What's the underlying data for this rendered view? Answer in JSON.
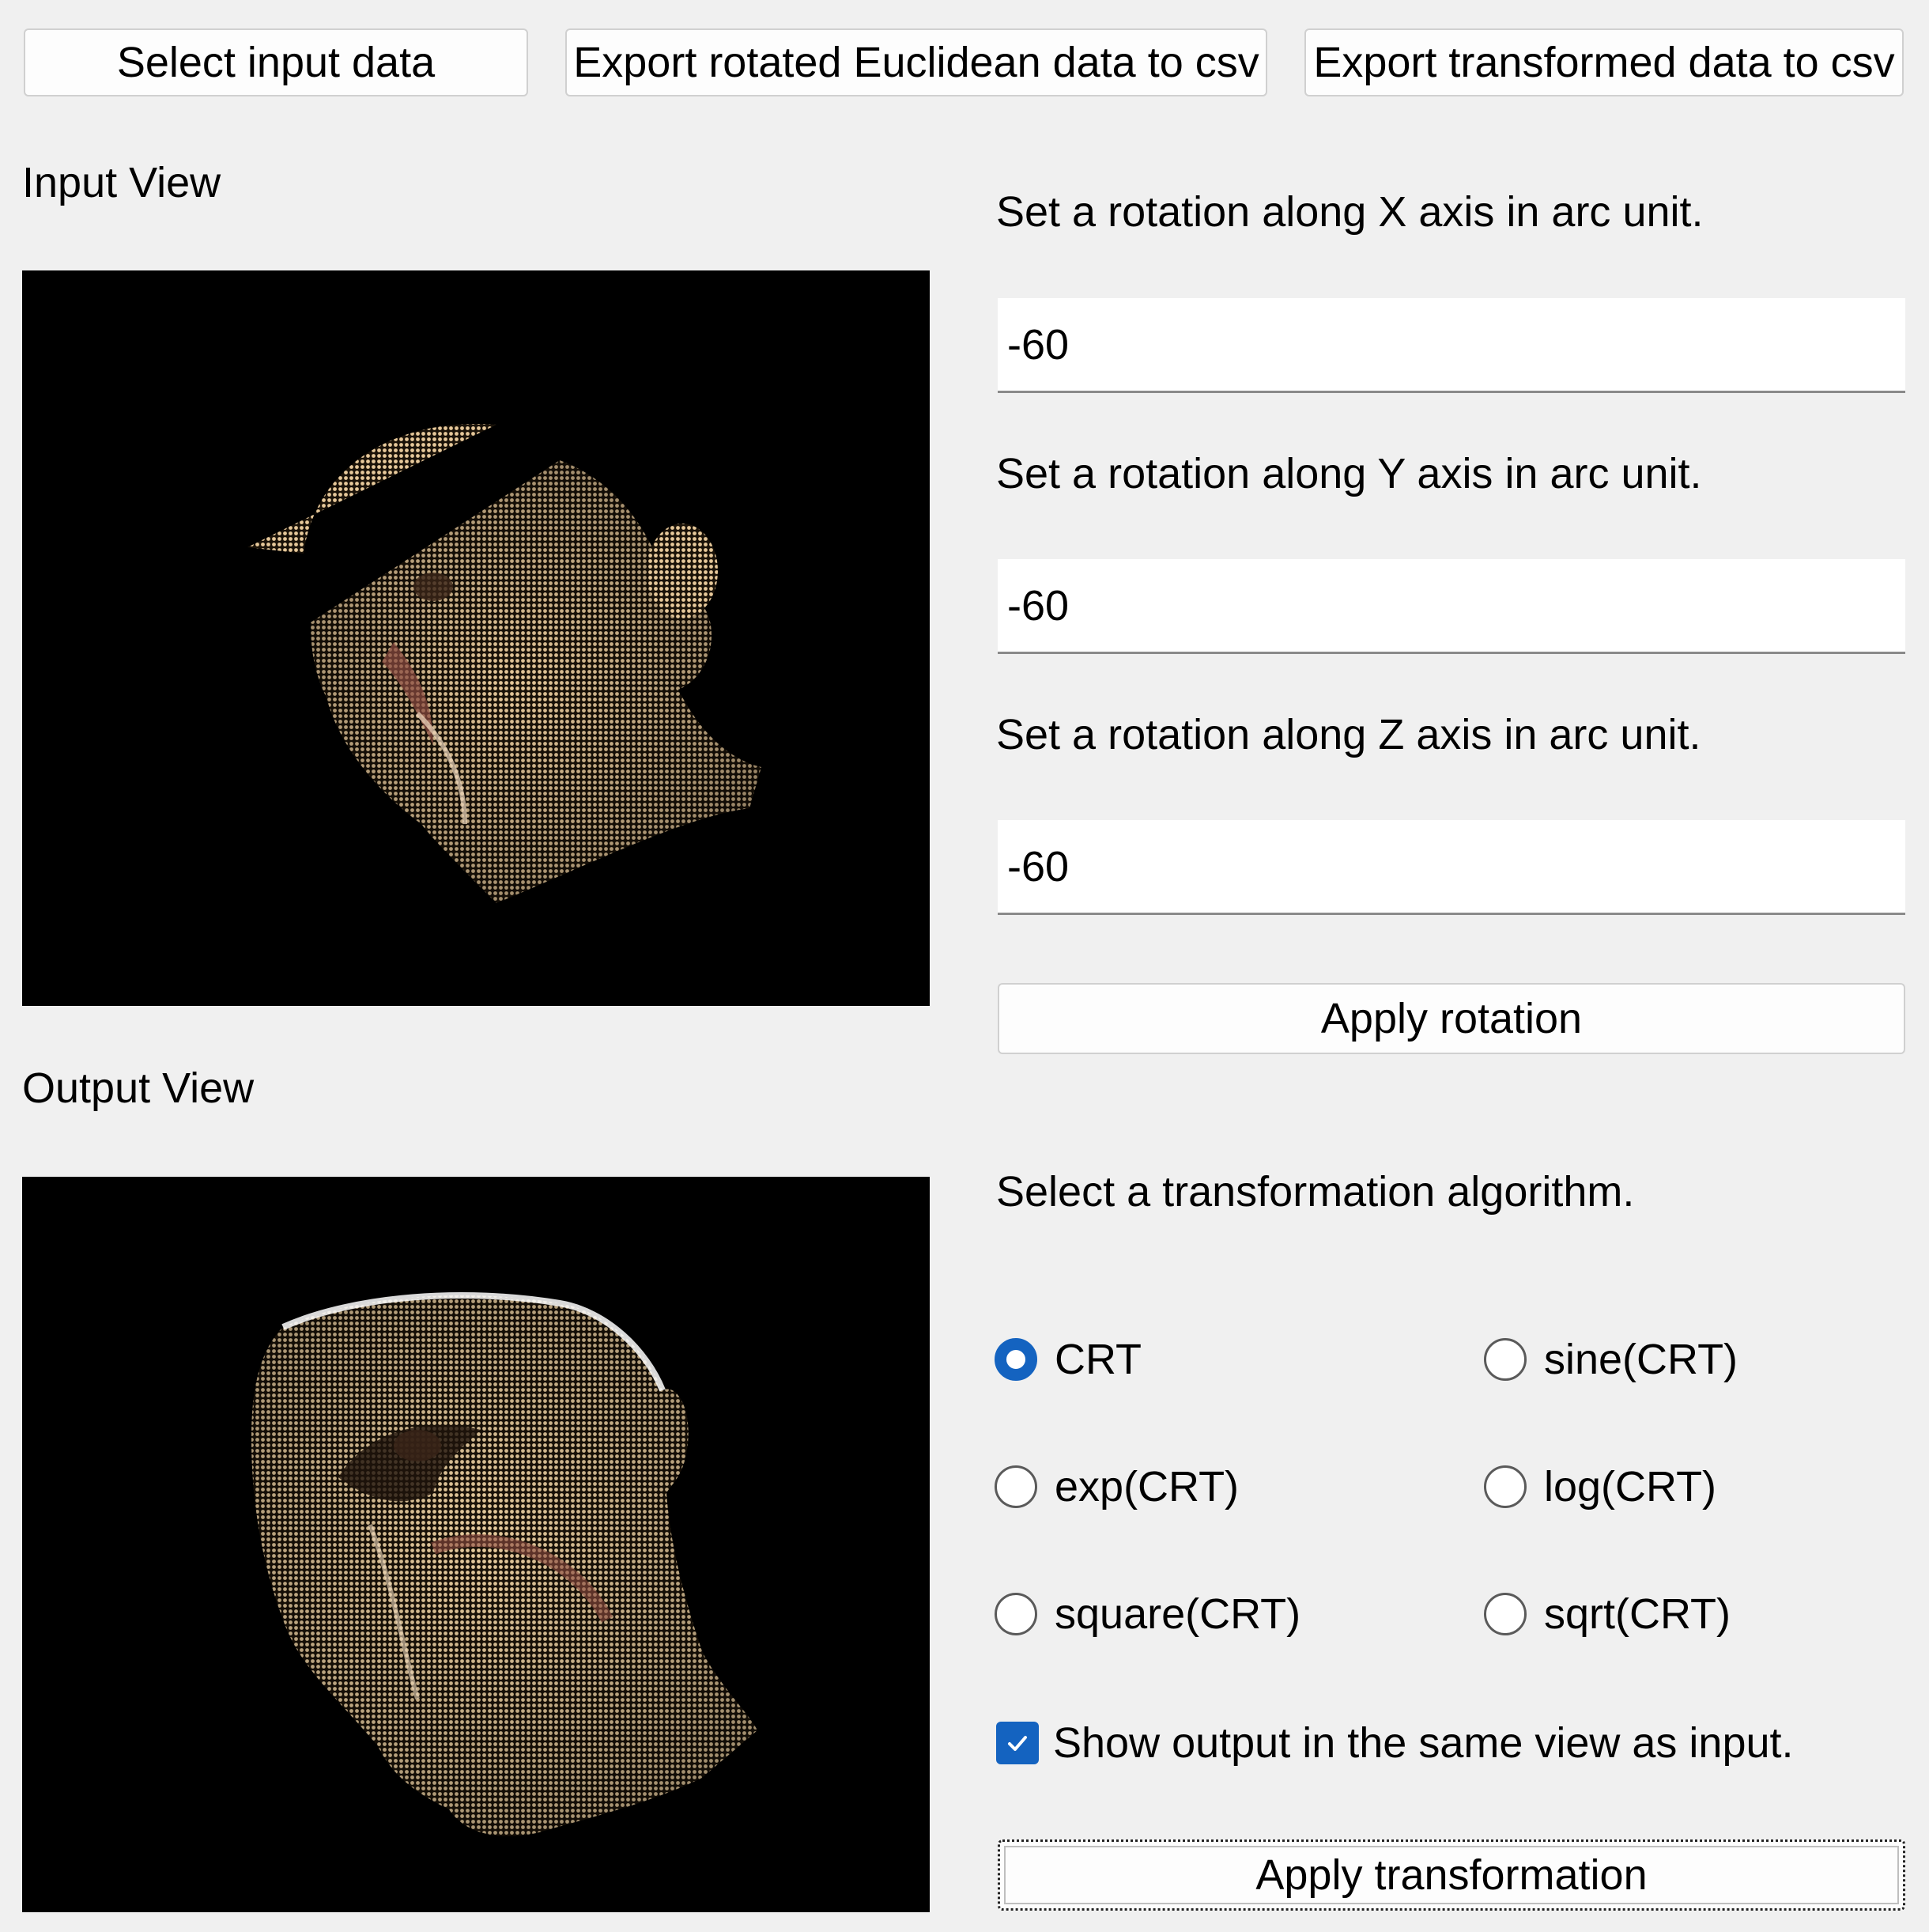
{
  "toolbar": {
    "select_input": "Select input data",
    "export_rotated": "Export rotated Euclidean data to csv",
    "export_transformed": "Export transformed data to csv"
  },
  "input_view": {
    "title": "Input View"
  },
  "output_view": {
    "title": "Output View"
  },
  "rotation": {
    "x_label": "Set a rotation along X axis in arc unit.",
    "x_value": "-60",
    "y_label": "Set a rotation along Y axis in arc unit.",
    "y_value": "-60",
    "z_label": "Set a rotation along Z axis in arc unit.",
    "z_value": "-60",
    "apply_label": "Apply rotation"
  },
  "transformation": {
    "title": "Select a transformation algorithm.",
    "options": [
      {
        "label": "CRT",
        "selected": true
      },
      {
        "label": "sine(CRT)",
        "selected": false
      },
      {
        "label": "exp(CRT)",
        "selected": false
      },
      {
        "label": "log(CRT)",
        "selected": false
      },
      {
        "label": "square(CRT)",
        "selected": false
      },
      {
        "label": "sqrt(CRT)",
        "selected": false
      }
    ],
    "same_view_label": "Show output in the same view as input.",
    "same_view_checked": true,
    "apply_label": "Apply transformation"
  },
  "colors": {
    "accent": "#1463c0",
    "background": "#f0f0f0",
    "view_bg": "#000000",
    "points": "#d8b98c"
  }
}
